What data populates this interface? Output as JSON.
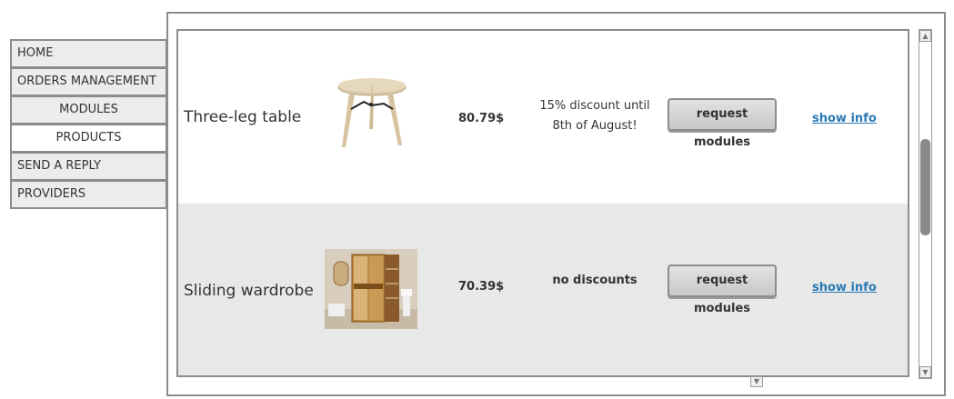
{
  "nav": {
    "items": [
      {
        "label": "HOME"
      },
      {
        "label": "ORDERS MANAGEMENT"
      },
      {
        "label": "MODULES"
      },
      {
        "label": "PRODUCTS"
      },
      {
        "label": "SEND A REPLY"
      },
      {
        "label": "PROVIDERS"
      }
    ],
    "active": "PRODUCTS"
  },
  "products": [
    {
      "name": "Three-leg table",
      "image_icon": "round-table-image",
      "price": "80.79$",
      "discount_line1": "15% discount until",
      "discount_line2": "8th of August!",
      "button": "request modules",
      "link": "show info"
    },
    {
      "name": "Sliding wardrobe",
      "image_icon": "wardrobe-image",
      "price": "70.39$",
      "discount_line1": "no discounts",
      "button": "request modules",
      "link": "show info"
    }
  ],
  "colors": {
    "link": "#2a7ab5",
    "border": "#8c8c8c",
    "row_alt": "#e8e8e8"
  },
  "scroll": {
    "up_glyph": "▲",
    "down_glyph": "▼"
  }
}
